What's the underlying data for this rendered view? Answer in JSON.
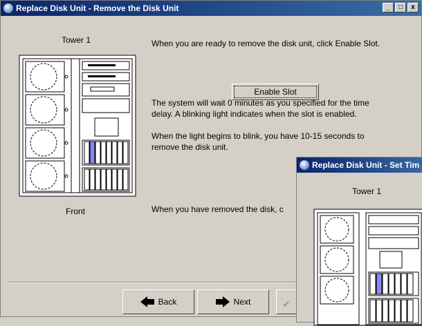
{
  "main_window": {
    "title": "Replace Disk Unit - Remove the Disk Unit",
    "controls": {
      "minimize": "_",
      "maximize": "□",
      "close": "x"
    },
    "tower_label": "Tower 1",
    "front_label": "Front",
    "instruction_1": "When you are ready to remove the disk unit, click Enable Slot.",
    "enable_button": "Enable Slot",
    "instruction_2_line1": "The system will wait 0 minutes as you specified for the time",
    "instruction_2_line2": "delay. A blinking light indicates when the slot is enabled.",
    "instruction_3_line1": "When the light begins to blink, you have 10-15 seconds to",
    "instruction_3_line2": "remove the disk unit.",
    "instruction_4": "When you have removed the disk, c",
    "back_button": "Back",
    "next_button": "Next"
  },
  "overlay_window": {
    "title": "Replace Disk Unit - Set Tim",
    "tower_label": "Tower 1"
  },
  "colors": {
    "titlebar_start": "#0a246a",
    "titlebar_end": "#3a6ea5",
    "face": "#d4d0c8",
    "highlight_slot": "#8888ee"
  }
}
